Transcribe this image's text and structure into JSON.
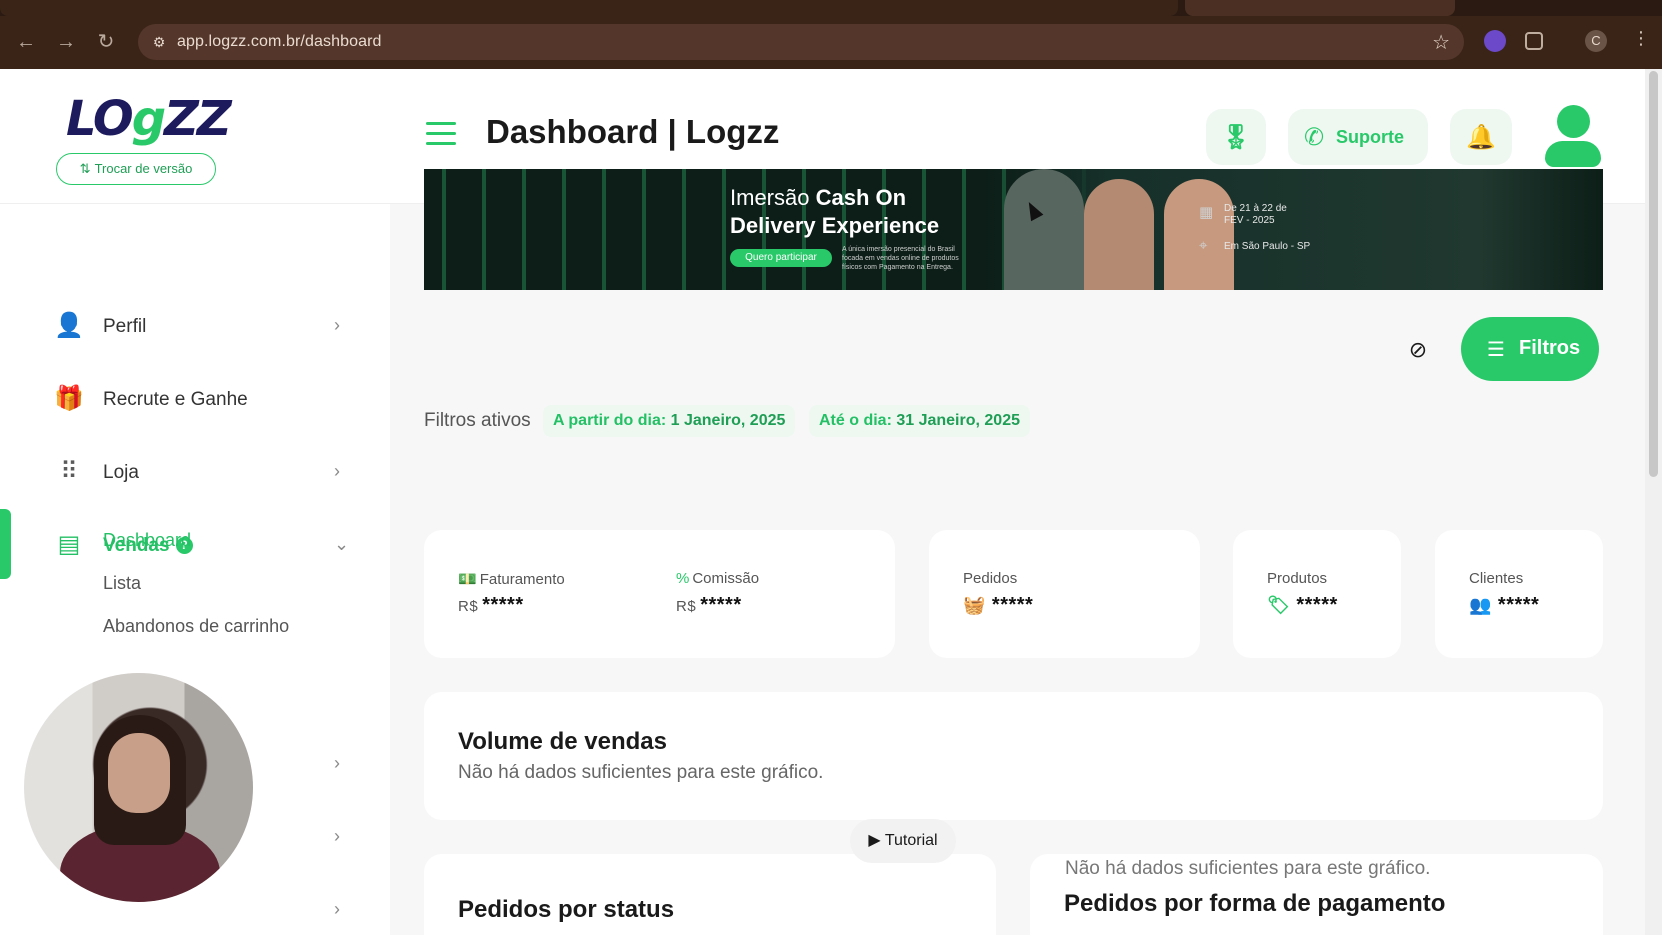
{
  "browser": {
    "url": "app.logzz.com.br/dashboard",
    "profile_initial": "C",
    "icons": [
      "back-icon",
      "forward-icon",
      "reload-icon",
      "site-settings-icon",
      "bookmark-star-icon",
      "extension-icon",
      "puzzle-icon",
      "profile-icon",
      "more-icon"
    ]
  },
  "brand": {
    "logo_text_1": "LO",
    "logo_text_g": "g",
    "logo_text_2": "ZZ",
    "switch_version": "Trocar de versão",
    "accent_color": "#29c96a",
    "logo_color": "#1d1b5e"
  },
  "header": {
    "title": "Dashboard | Logzz",
    "support_label": "Suporte"
  },
  "sidebar": {
    "items": [
      {
        "label": "Perfil",
        "icon": "user-icon"
      },
      {
        "label": "Recrute e Ganhe",
        "icon": "gift-icon"
      },
      {
        "label": "Loja",
        "icon": "grid-icon"
      },
      {
        "label": "Vendas",
        "icon": "sales-icon",
        "badge": "?"
      }
    ],
    "submenu": [
      {
        "label": "Dashboard"
      },
      {
        "label": "Lista"
      },
      {
        "label": "Abandonos de carrinho"
      }
    ]
  },
  "banner": {
    "line1_pre": "Imersão",
    "line1_bold": "Cash On",
    "line2": "Delivery Experience",
    "cta": "Quero participar",
    "description": "A única imersão presencial do Brasil focada em vendas online de produtos físicos com Pagamento na Entrega.",
    "date_line1": "De 21 à 22 de",
    "date_line2": "FEV - 2025",
    "location": "Em São Paulo - SP"
  },
  "filters": {
    "button_label": "Filtros",
    "active_label": "Filtros ativos",
    "from_prefix": "A partir do dia:",
    "from_value": "1 Janeiro, 2025",
    "to_prefix": "Até o dia:",
    "to_value": "31 Janeiro, 2025"
  },
  "stats": {
    "faturamento": {
      "label": "Faturamento",
      "currency": "R$",
      "value": "*****"
    },
    "comissao": {
      "label": "Comissão",
      "currency": "R$",
      "value": "*****"
    },
    "pedidos": {
      "label": "Pedidos",
      "value": "*****"
    },
    "produtos": {
      "label": "Produtos",
      "value": "*****"
    },
    "clientes": {
      "label": "Clientes",
      "value": "*****"
    }
  },
  "sections": {
    "volume_title": "Volume de vendas",
    "volume_empty": "Não há dados suficientes para este gráfico.",
    "status_title": "Pedidos por status",
    "tutorial_label": "Tutorial",
    "payment_title": "Pedidos por forma de pagamento",
    "payment_empty": "Não há dados suficientes para este gráfico."
  }
}
